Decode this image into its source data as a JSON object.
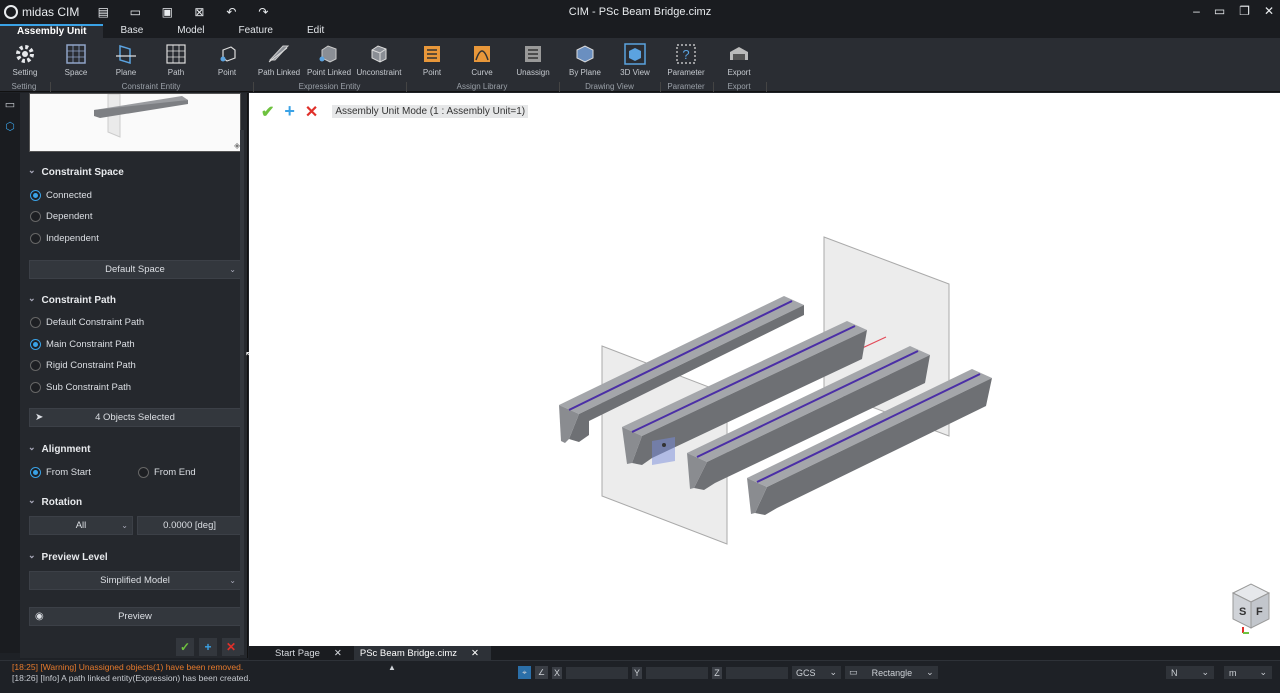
{
  "app": {
    "logo_text": "midas CIM",
    "window_title": "CIM - PSc Beam Bridge.cimz",
    "quick_access": [
      "new-file-icon",
      "open-folder-icon",
      "save-icon",
      "save-as-icon",
      "undo-icon",
      "redo-icon"
    ],
    "window_controls": [
      "minimize-icon",
      "tile-icon",
      "restore-icon",
      "close-icon"
    ]
  },
  "menu": {
    "tabs": [
      "Assembly Unit",
      "Base",
      "Model",
      "Feature",
      "Edit"
    ],
    "active": "Assembly Unit"
  },
  "ribbon": {
    "buttons": {
      "setting": "Setting",
      "space": "Space",
      "plane": "Plane",
      "path": "Path",
      "point": "Point",
      "path_linked": "Path Linked",
      "point_linked": "Point Linked",
      "unconstraint": "Unconstraint",
      "assign_point": "Point",
      "curve": "Curve",
      "unassign": "Unassign",
      "by_plane": "By Plane",
      "view_3d": "3D View",
      "parameter": "Parameter",
      "export": "Export"
    },
    "groups": {
      "setting": "Setting",
      "constraint_entity": "Constraint Entity",
      "expression_entity": "Expression Entity",
      "assign_library": "Assign Library",
      "drawing_view": "Drawing View",
      "parameter": "Parameter",
      "export": "Export"
    }
  },
  "panel": {
    "constraint_space": {
      "title": "Constraint Space",
      "options": [
        "Connected",
        "Dependent",
        "Independent"
      ],
      "selected": 0,
      "space_select": "Default Space"
    },
    "constraint_path": {
      "title": "Constraint Path",
      "options": [
        "Default Constraint Path",
        "Main Constraint Path",
        "Rigid Constraint Path",
        "Sub Constraint Path"
      ],
      "selected": 1,
      "objects_selected": "4 Objects Selected"
    },
    "alignment": {
      "title": "Alignment",
      "options": [
        "From Start",
        "From End"
      ],
      "selected": 0
    },
    "rotation": {
      "title": "Rotation",
      "axis": "All",
      "angle": "0.0000 [deg]"
    },
    "preview_level": {
      "title": "Preview Level",
      "level": "Simplified Model",
      "preview_button": "Preview"
    }
  },
  "viewport": {
    "mode_label": "Assembly Unit Mode (1 : Assembly Unit=1)"
  },
  "doc_tabs": [
    "Start Page",
    "PSc Beam Bridge.cimz"
  ],
  "doc_tab_active": 1,
  "log": {
    "warning": "[18:25] [Warning] Unassigned objects(1) have been removed.",
    "info": "[18:26] [Info] A path linked entity(Expression) has been created."
  },
  "status": {
    "x_label": "X",
    "y_label": "Y",
    "z_label": "Z",
    "coord_system": "GCS",
    "select_mode": "Rectangle",
    "force_unit": "N",
    "length_unit": "m"
  },
  "colors": {
    "accent": "#3aa2e6",
    "confirm": "#6ec23f",
    "cancel": "#e0302a",
    "warning": "#e67a2c"
  }
}
